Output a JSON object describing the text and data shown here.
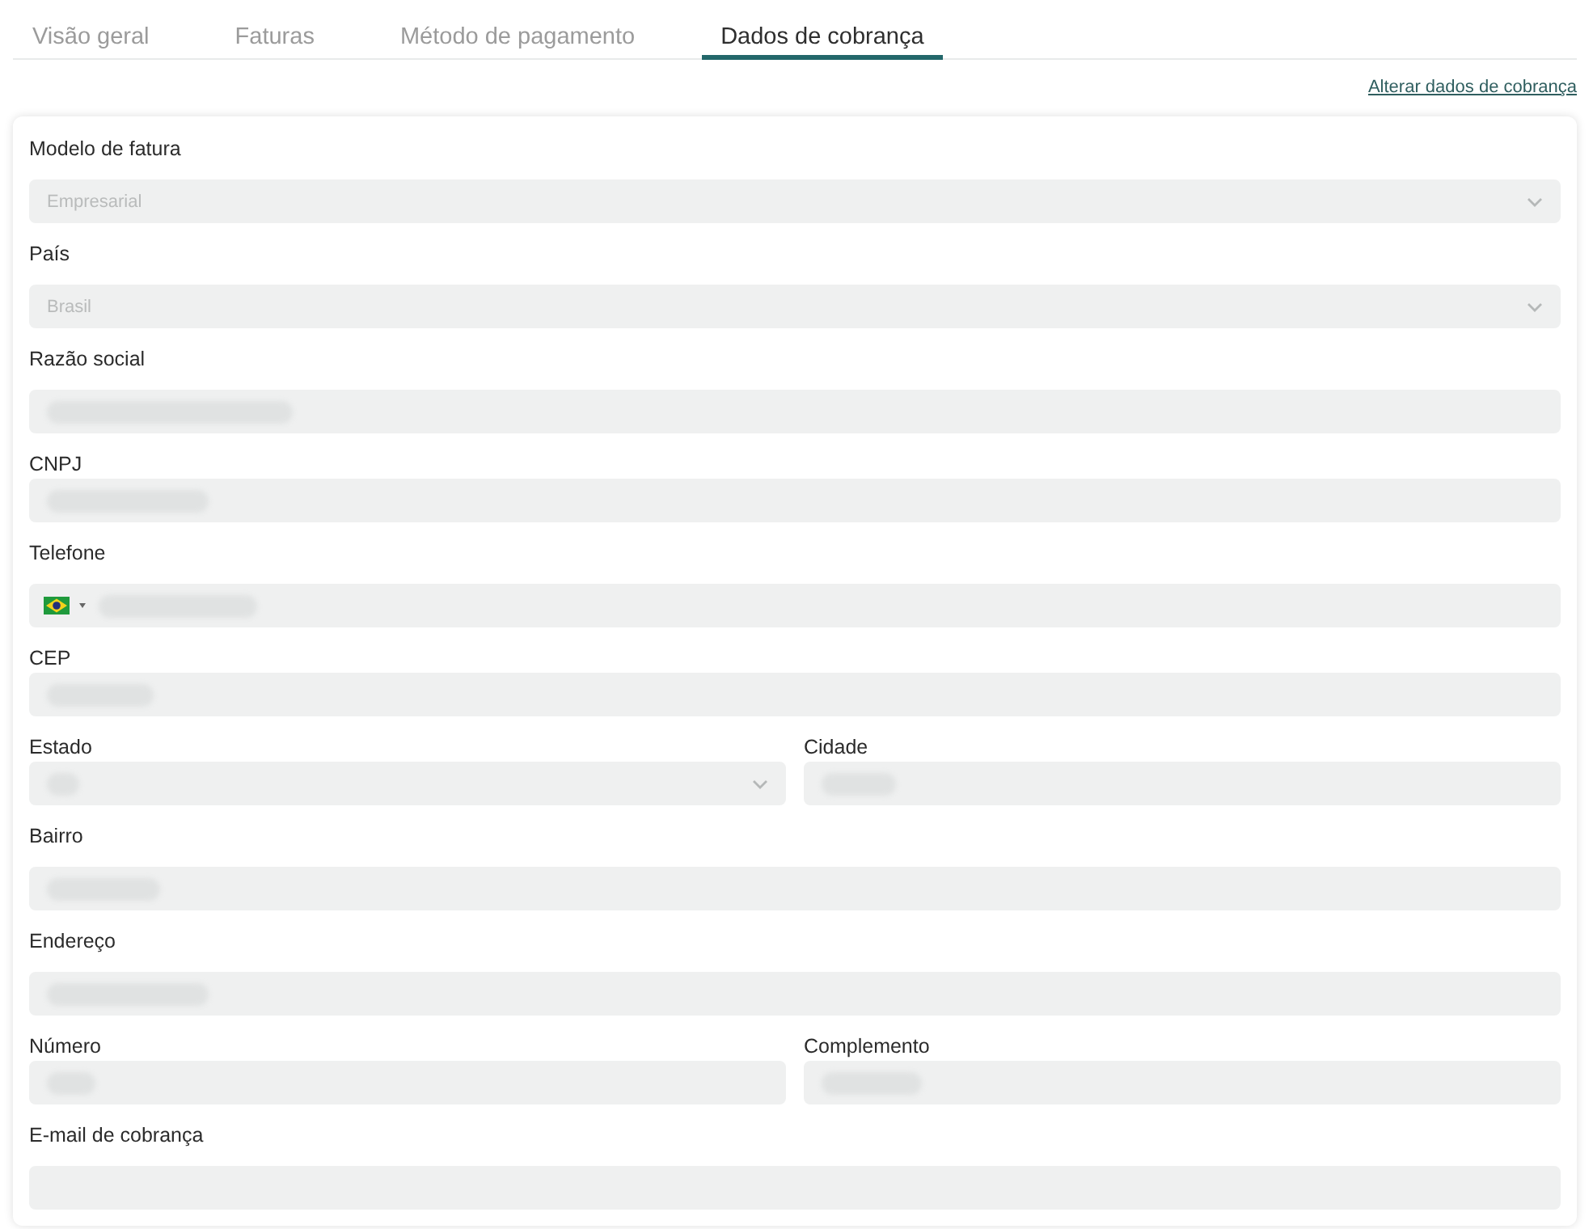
{
  "tabs": [
    {
      "label": "Visão geral",
      "selected": false
    },
    {
      "label": "Faturas",
      "selected": false
    },
    {
      "label": "Método de pagamento",
      "selected": false
    },
    {
      "label": "Dados de cobrança",
      "selected": true
    }
  ],
  "change_link": "Alterar dados de cobrança",
  "form": {
    "rows": [
      {
        "fields": [
          {
            "label": "Modelo de fatura",
            "kind": "select",
            "value": "Empresarial",
            "disabled": true,
            "redacted": false
          }
        ]
      },
      {
        "fields": [
          {
            "label": "País",
            "kind": "select",
            "value": "Brasil",
            "disabled": true,
            "redacted": false
          }
        ]
      },
      {
        "fields": [
          {
            "label": "Razão social",
            "kind": "text",
            "disabled": true,
            "redacted": true
          }
        ]
      },
      {
        "fields": [
          {
            "label": "CNPJ",
            "kind": "text",
            "disabled": true,
            "redacted": true
          }
        ]
      },
      {
        "fields": [
          {
            "label": "Telefone",
            "kind": "phone",
            "disabled": true,
            "redacted": true
          }
        ]
      },
      {
        "fields": [
          {
            "label": "CEP",
            "kind": "text",
            "disabled": true,
            "redacted": true
          }
        ]
      },
      {
        "fields": [
          {
            "label": "Estado",
            "kind": "select",
            "disabled": true,
            "redacted": true
          },
          {
            "label": "Cidade",
            "kind": "text",
            "disabled": true,
            "redacted": true
          }
        ]
      },
      {
        "fields": [
          {
            "label": "Bairro",
            "kind": "text",
            "disabled": true,
            "redacted": true
          }
        ]
      },
      {
        "fields": [
          {
            "label": "Endereço",
            "kind": "text",
            "disabled": true,
            "redacted": true
          }
        ]
      },
      {
        "fields": [
          {
            "label": "Número",
            "kind": "text",
            "disabled": true,
            "redacted": true
          },
          {
            "label": "Complemento",
            "kind": "text",
            "disabled": true,
            "redacted": true
          }
        ]
      },
      {
        "fields": [
          {
            "label": "E-mail de cobrança",
            "kind": "text",
            "disabled": true,
            "redacted": false
          }
        ]
      }
    ]
  }
}
